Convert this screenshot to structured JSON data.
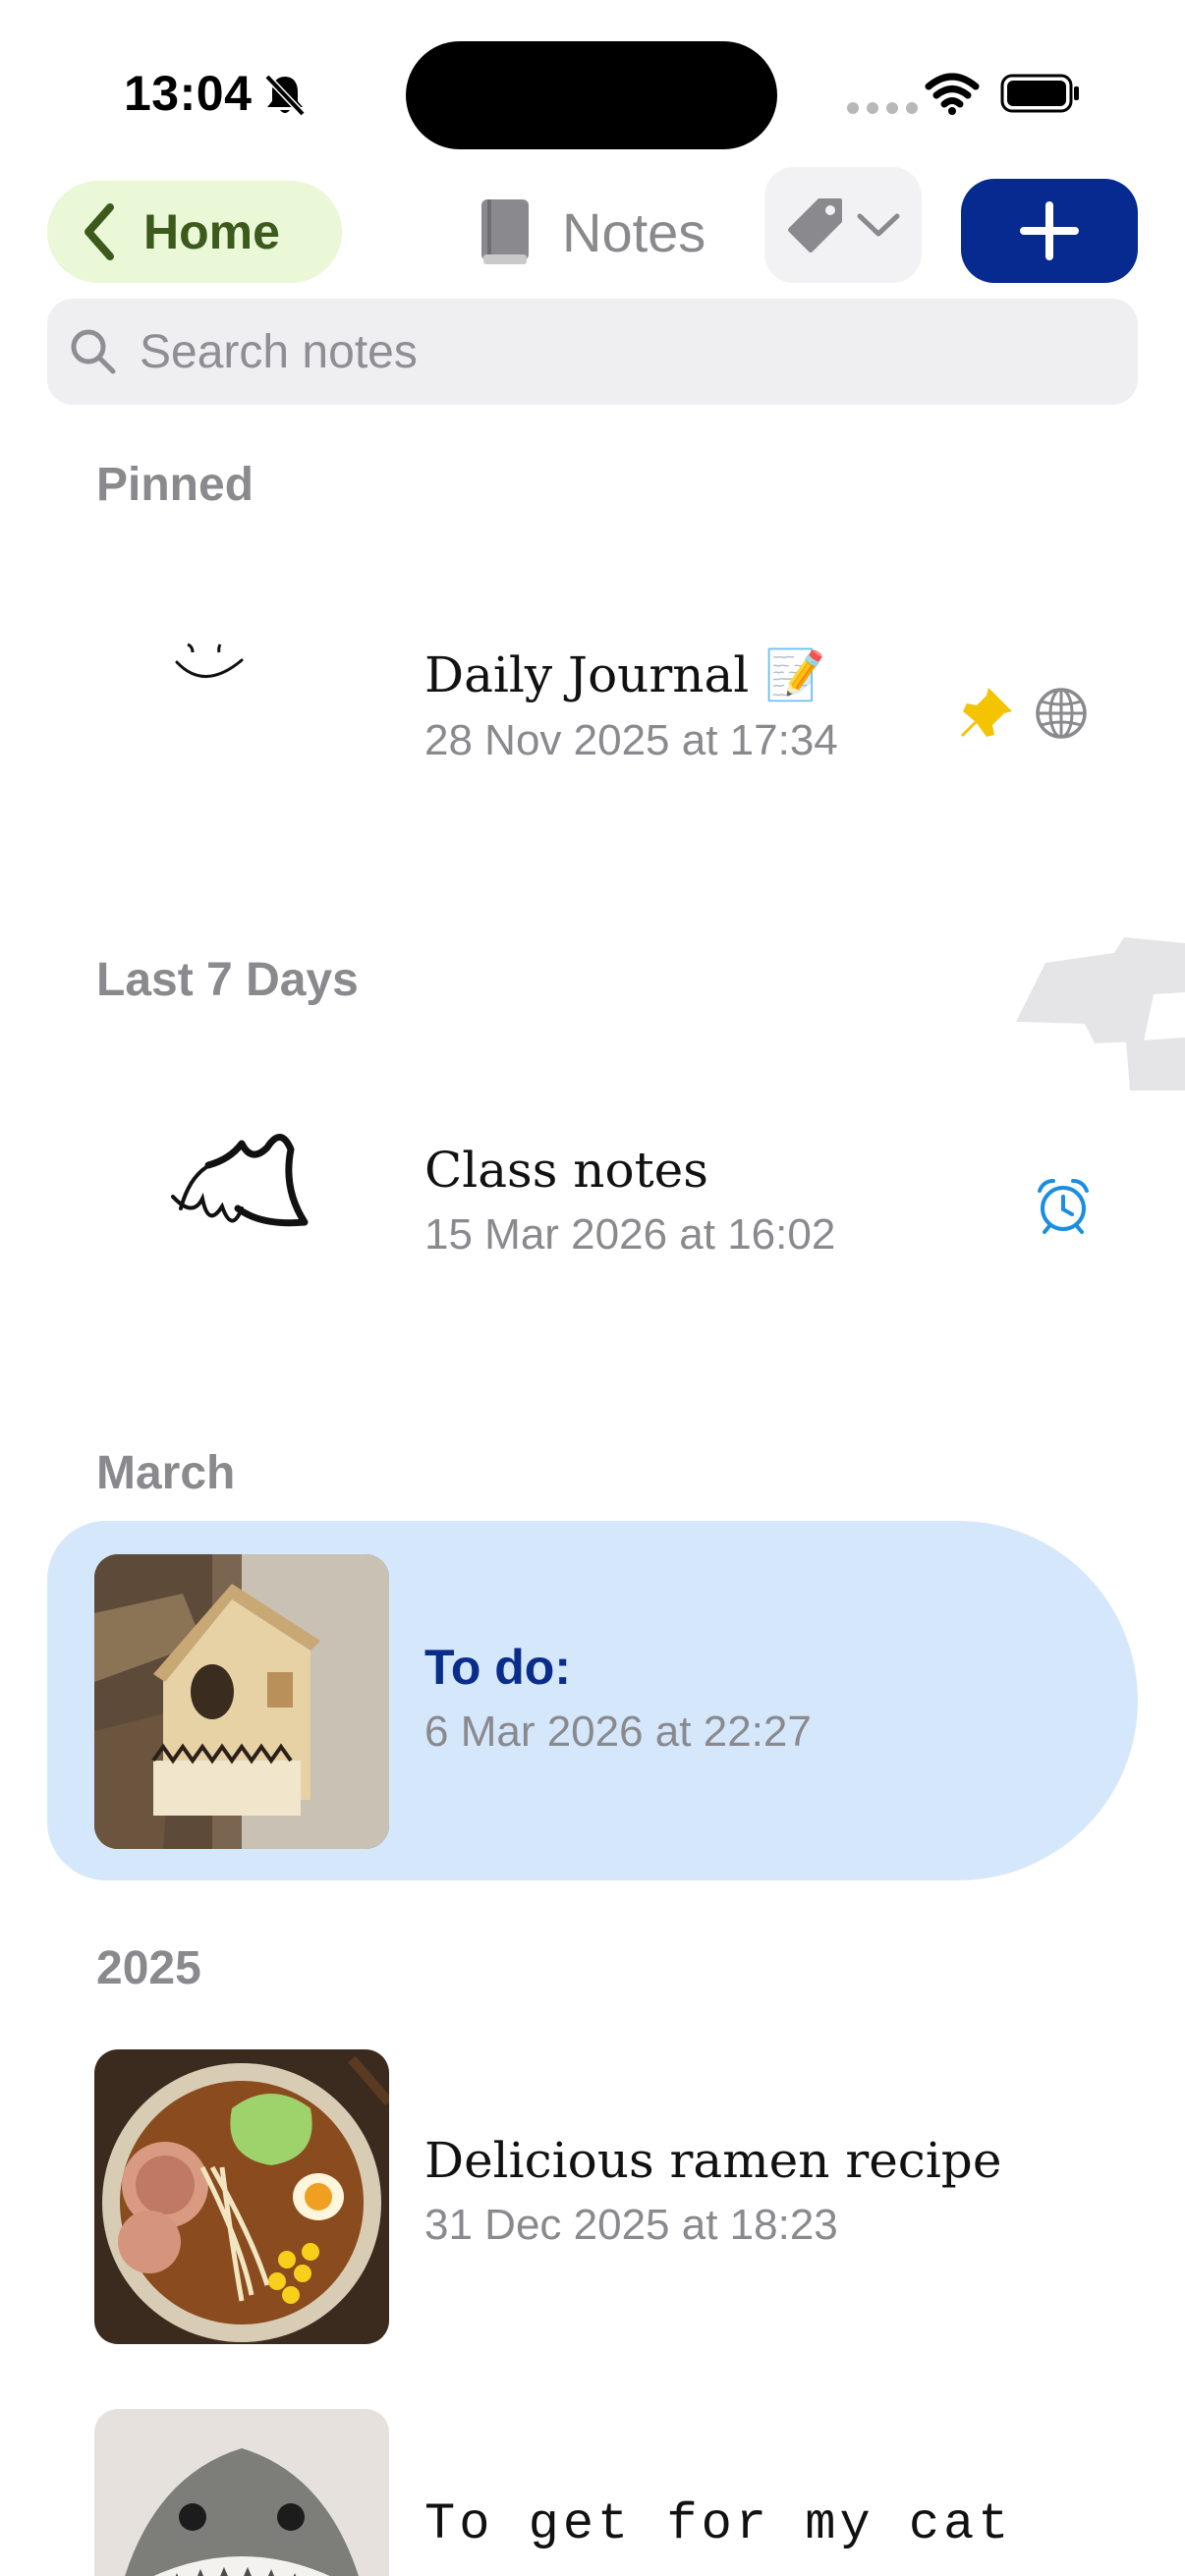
{
  "status_bar": {
    "time": "13:04"
  },
  "toolbar": {
    "back_label": "Home",
    "title": "Notes"
  },
  "search": {
    "placeholder": "Search notes"
  },
  "sections": [
    {
      "header": "Pinned",
      "notes": [
        {
          "title": "Daily Journal 📝",
          "date": "28 Nov 2025 at 17:34",
          "badges": [
            "pin-icon",
            "globe-icon"
          ]
        }
      ]
    },
    {
      "header": "Last 7 Days",
      "notes": [
        {
          "title": "Class notes",
          "date": "15 Mar 2026 at 16:02",
          "badges": [
            "alarm-icon"
          ]
        }
      ]
    },
    {
      "header": "March",
      "notes": [
        {
          "title": "To do:",
          "date": "6 Mar 2026 at 22:27",
          "selected": true
        }
      ]
    },
    {
      "header": "2025",
      "notes": [
        {
          "title": "Delicious ramen recipe",
          "date": "31 Dec 2025 at 18:23"
        },
        {
          "title": "To get for my cat",
          "date": ""
        }
      ]
    }
  ],
  "colors": {
    "home_pill_bg": "#eaf8d8",
    "home_pill_text": "#3c5a1c",
    "add_button_bg": "#062a8f",
    "selected_row_bg": "#d5e8fb",
    "selected_title": "#0a2d8a",
    "pin": "#f5c400",
    "alarm": "#1a8fe0"
  }
}
